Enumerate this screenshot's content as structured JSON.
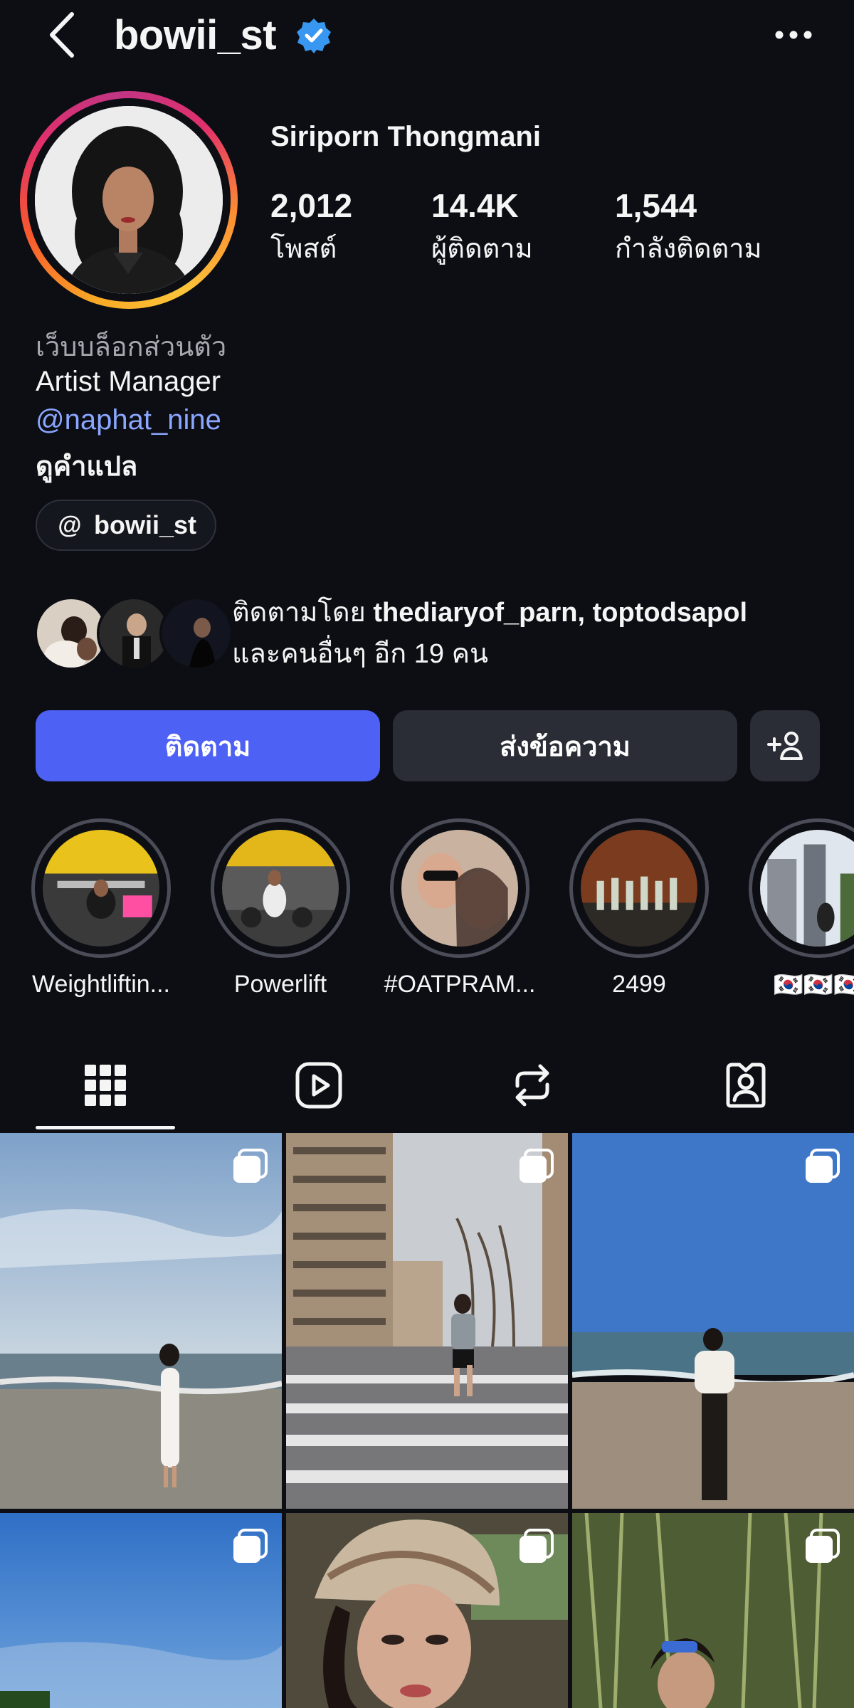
{
  "header": {
    "username": "bowii_st",
    "verified": true,
    "back_icon": "chevron-left-icon",
    "more_icon": "more-horizontal-icon"
  },
  "profile": {
    "full_name": "Siriporn Thongmani",
    "stats": [
      {
        "value": "2,012",
        "label": "โพสต์"
      },
      {
        "value": "14.4K",
        "label": "ผู้ติดตาม"
      },
      {
        "value": "1,544",
        "label": "กำลังติดตาม"
      }
    ],
    "bio": {
      "category": "เว็บบล็อกส่วนตัว",
      "text": "Artist Manager",
      "mention": "@naphat_nine",
      "translate": "ดูคำแปล"
    },
    "threads": {
      "label": "bowii_st",
      "icon": "threads-icon"
    }
  },
  "followed_by": {
    "prefix": "ติดตามโดย",
    "names": "thediaryof_parn, toptodsapol",
    "suffix": "และคนอื่นๆ อีก 19 คน"
  },
  "actions": {
    "follow_label": "ติดตาม",
    "message_label": "ส่งข้อความ",
    "add_user_icon": "add-user-icon"
  },
  "highlights": [
    {
      "label": "Weightliftin..."
    },
    {
      "label": "Powerlift"
    },
    {
      "label": "#OATPRAM..."
    },
    {
      "label": "2499"
    },
    {
      "label": "🇰🇷🇰🇷🇰🇷"
    }
  ],
  "tabs": [
    {
      "name": "posts",
      "icon": "grid-icon",
      "active": true
    },
    {
      "name": "reels",
      "icon": "reels-icon",
      "active": false
    },
    {
      "name": "reposts",
      "icon": "repost-icon",
      "active": false
    },
    {
      "name": "tagged",
      "icon": "tagged-icon",
      "active": false
    }
  ],
  "posts": [
    {
      "scene": "beach-white-dress",
      "multi": true
    },
    {
      "scene": "street-runner",
      "multi": true
    },
    {
      "scene": "beach-off-shoulder",
      "multi": true
    },
    {
      "scene": "sky",
      "multi": true
    },
    {
      "scene": "bandana-portrait",
      "multi": true
    },
    {
      "scene": "forest-selfie",
      "multi": true
    }
  ],
  "colors": {
    "background": "#0c0e14",
    "follow_button": "#4e61f5",
    "secondary_button": "#2a2d36",
    "link": "#8aa6ff",
    "verified": "#3897f0"
  }
}
